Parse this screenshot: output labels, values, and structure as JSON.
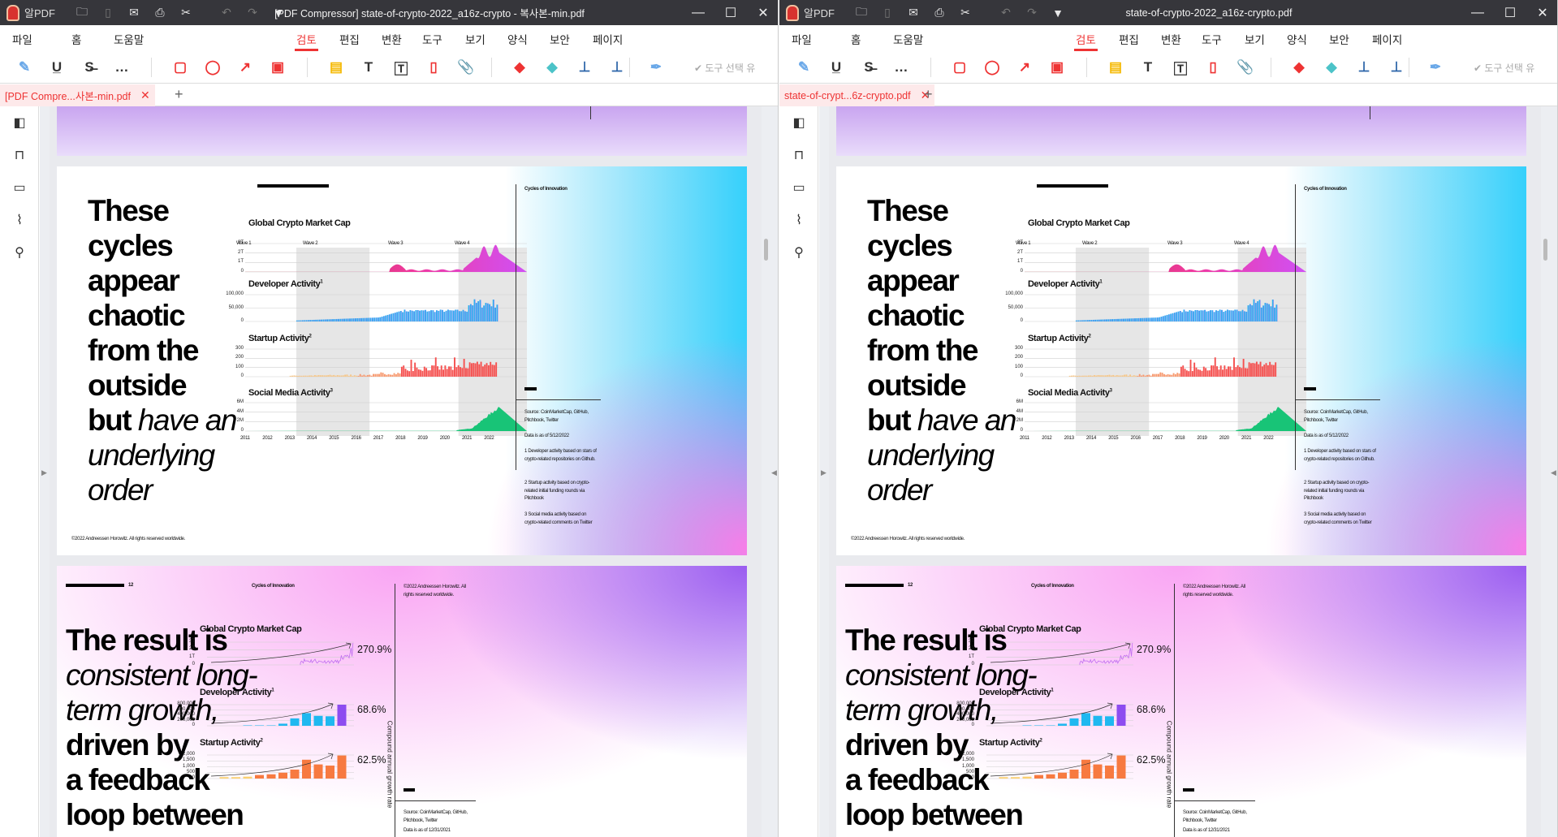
{
  "windows": [
    {
      "title": "[PDF Compressor] state-of-crypto-2022_a16z-crypto - 복사본-min.pdf",
      "tab_label": "[PDF Compre...사본-min.pdf"
    },
    {
      "title": "state-of-crypto-2022_a16z-crypto.pdf",
      "tab_label": "state-of-crypt...6z-crypto.pdf"
    }
  ],
  "app": {
    "name": "알PDF",
    "menu": [
      "파일",
      "홈",
      "도움말",
      "검토",
      "편집",
      "변환",
      "도구",
      "보기",
      "양식",
      "보안",
      "페이지"
    ],
    "active_menu": "검토",
    "tool_select_label": "도구 선택 유",
    "accent": "#e33333",
    "titlebar_bg": "#36363b"
  },
  "toolbar_icons": [
    "highlight-icon",
    "underline-icon",
    "strikethrough-icon",
    "more-icon",
    "rectangle-icon",
    "circle-icon",
    "arrow-icon",
    "shape-icon",
    "sticky-note-icon",
    "text-icon",
    "textbox-icon",
    "callout-icon",
    "attachment-icon",
    "eraser-red-icon",
    "eraser-teal-icon",
    "stamp-icon",
    "stamp-dropdown-icon",
    "signature-icon"
  ],
  "sidebar_icons": [
    "thumbnail-icon",
    "bookmark-icon",
    "comment-icon",
    "attachment-icon",
    "search-icon"
  ],
  "document": {
    "page2": {
      "headline": {
        "bold1": "These",
        "bold2": "cycles",
        "bold3": "appear",
        "bold4": "chaotic",
        "bold5": "from the",
        "bold6": "outside",
        "bold7": "but",
        "italic1": "have an",
        "italic2": "underlying",
        "italic3": "order"
      },
      "section": "Cycles of Innovation",
      "copyright": "©2022 Andreessen Horowitz. All rights reserved worldwide.",
      "waves": [
        "Wave 1",
        "Wave 2",
        "Wave 3",
        "Wave 4"
      ],
      "charts": [
        {
          "title": "Global Crypto Market Cap",
          "sup": "",
          "ticks": [
            "3T",
            "2T",
            "1T",
            "0"
          ]
        },
        {
          "title": "Developer Activity",
          "sup": "1",
          "ticks": [
            "100,000",
            "50,000",
            "0"
          ]
        },
        {
          "title": "Startup Activity",
          "sup": "2",
          "ticks": [
            "300",
            "200",
            "100",
            "0"
          ]
        },
        {
          "title": "Social Media Activity",
          "sup": "3",
          "ticks": [
            "6M",
            "4M",
            "2M",
            "0"
          ]
        }
      ],
      "years": [
        "2011",
        "2012",
        "2013",
        "2014",
        "2015",
        "2016",
        "2017",
        "2018",
        "2019",
        "2020",
        "2021",
        "2022"
      ],
      "source": "Source: CoinMarketCap, GitHub, Pitchbook, Twitter",
      "data_as_of": "Data is as of 5/12/2022",
      "notes": [
        "1 Developer activity based on stars of crypto-related repositories on Github.",
        "2 Startup activity based on crypto-related initial funding rounds via Pitchbook",
        "3 Social media activity based on crypto-related comments on Twitter"
      ]
    },
    "page3": {
      "page_number": "12",
      "section": "Cycles of Innovation",
      "headline": {
        "bold1": "The result is",
        "italic1": "consistent long-",
        "italic2": "term growth,",
        "bold2": "driven by",
        "bold3": "a feedback",
        "bold4": "loop between"
      },
      "copyright": "©2022 Andreessen Horowitz. All rights reserved worldwide.",
      "charts": [
        {
          "title": "Global Crypto Market Cap",
          "sup": "",
          "ticks": [
            "3T",
            "2T",
            "1T",
            "0"
          ],
          "cagr": "270.9%"
        },
        {
          "title": "Developer Activity",
          "sup": "1",
          "ticks": [
            "800,000",
            "600,000",
            "400,000",
            "200,000",
            "0"
          ],
          "cagr": "68.6%"
        },
        {
          "title": "Startup Activity",
          "sup": "2",
          "ticks": [
            "2,000",
            "1,500",
            "1,000",
            "500",
            "0"
          ],
          "cagr": "62.5%"
        }
      ],
      "vertical_label": "Compound annual growth rate",
      "source": "Source: CoinMarketCap, GitHub, Pitchbook, Twitter",
      "data_as_of": "Data is as of 12/31/2021"
    }
  }
}
